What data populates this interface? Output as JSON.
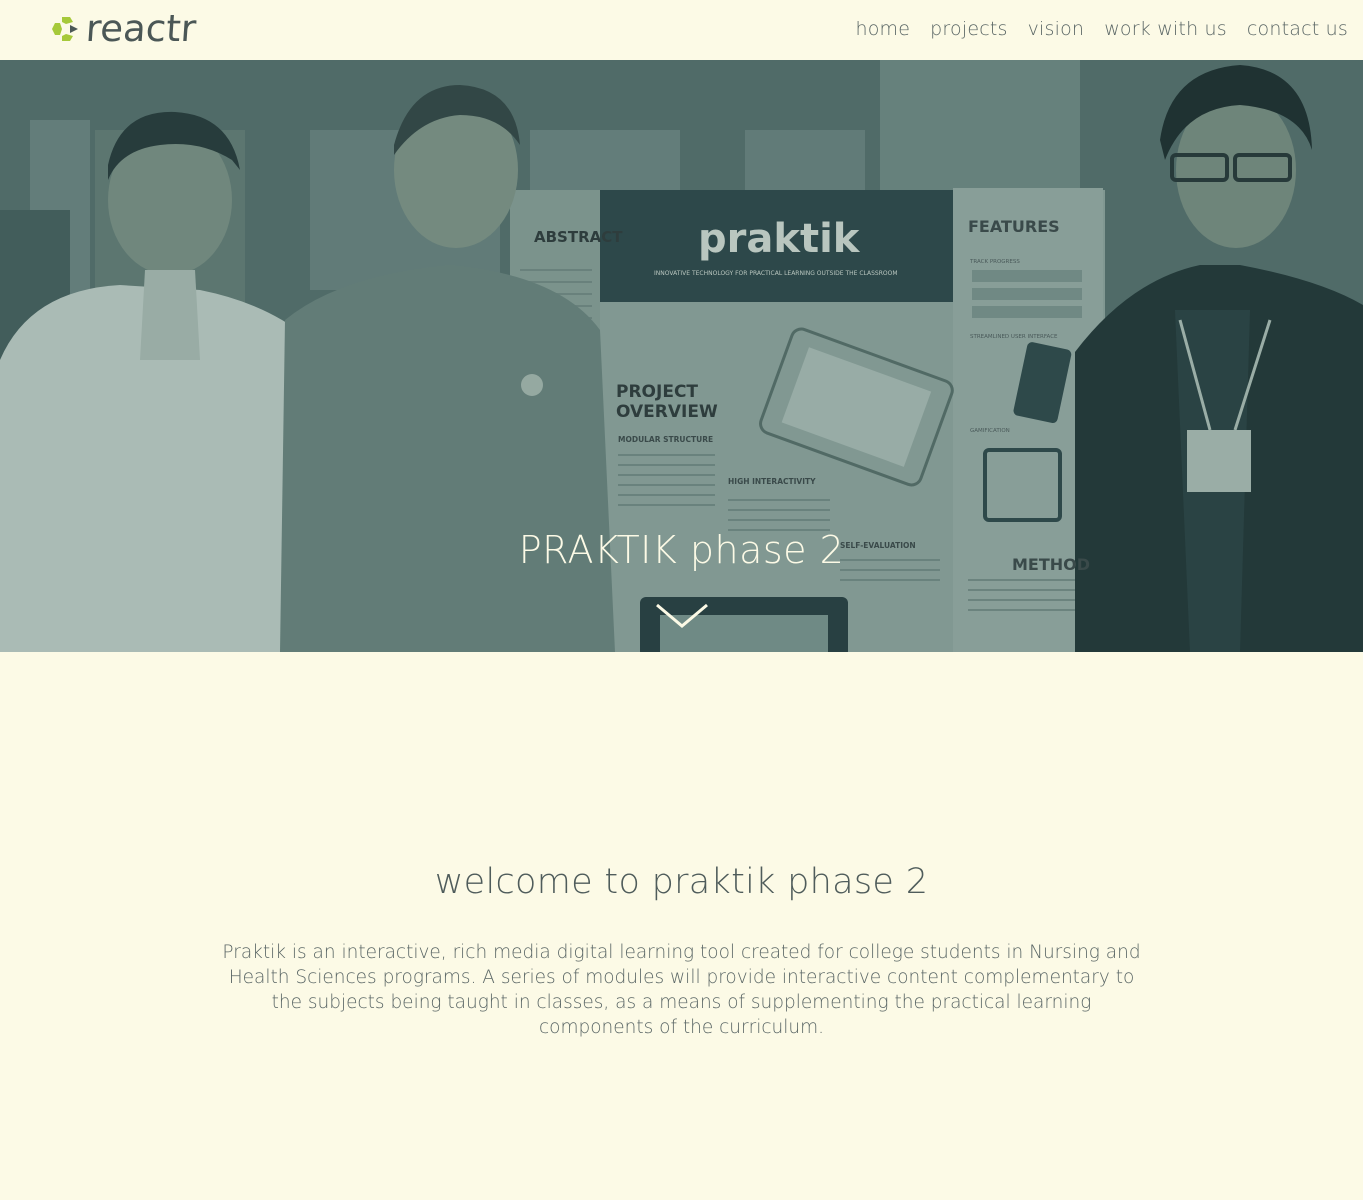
{
  "header": {
    "logo_text": "reactr",
    "nav": [
      {
        "label": "home"
      },
      {
        "label": "projects"
      },
      {
        "label": "vision"
      },
      {
        "label": "work with us"
      },
      {
        "label": "contact us"
      }
    ]
  },
  "hero": {
    "title": "PRAKTIK phase 2",
    "poster": {
      "brand": "praktik",
      "tagline": "INNOVATIVE TECHNOLOGY FOR PRACTICAL LEARNING OUTSIDE THE CLASSROOM",
      "abstract": "ABSTRACT",
      "project_overview_1": "PROJECT",
      "project_overview_2": "OVERVIEW",
      "modular_structure": "MODULAR STRUCTURE",
      "high_interactivity": "HIGH INTERACTIVITY",
      "self_evaluation": "SELF-EVALUATION",
      "features": "FEATURES",
      "track_progress": "TRACK PROGRESS",
      "streamlined_ui": "STREAMLINED USER INTERFACE",
      "gamification": "GAMIFICATION",
      "method": "METHOD"
    }
  },
  "intro": {
    "title": "welcome to praktik phase 2",
    "body": "Praktik is an interactive, rich media digital learning tool created for college students in Nursing and Health Sciences programs. A series of modules will provide interactive content complementary to the subjects being taught in classes, as a means of supplementing the practical learning components of the curriculum."
  },
  "colors": {
    "background": "#fcfae6",
    "text": "#4d5a5a",
    "logo_green": "#a6c93a",
    "hero_tint": "#5e7370"
  }
}
